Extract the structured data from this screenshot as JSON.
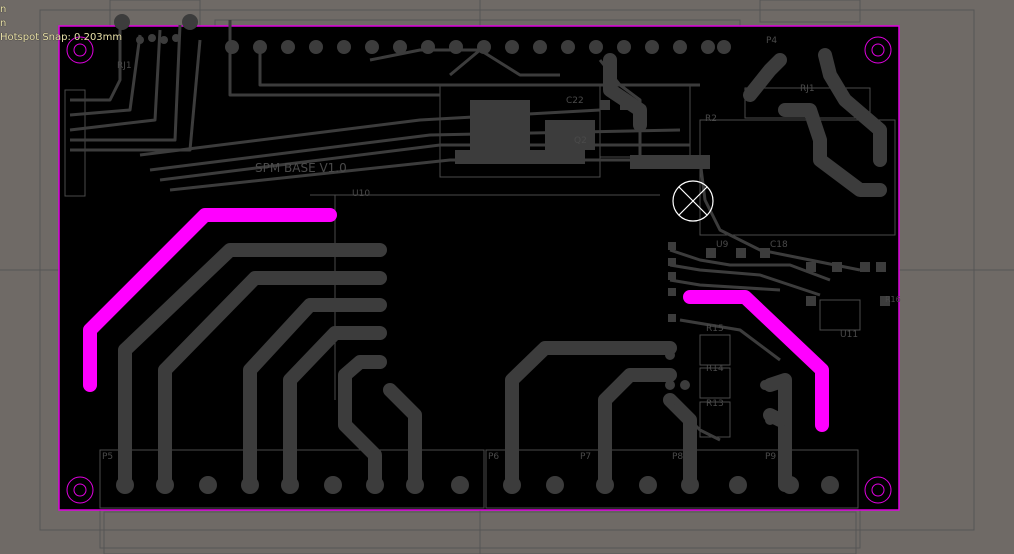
{
  "status": {
    "line1": "n",
    "line2": "n",
    "snap": "Hotspot Snap: 0.203mm"
  },
  "colors": {
    "background": "#6f6a66",
    "board": "#000000",
    "board_outline": "#e000e0",
    "trace": "#3c3c3c",
    "highlight_trace": "#ff00ff",
    "silkscreen": "#4a4a4a",
    "mechanical": "#555555"
  },
  "board": {
    "title_silk": "SPM BASE V1.0",
    "sub_silk": "U10"
  },
  "designators": {
    "rj1": "RJ1",
    "p4": "P4",
    "p5": "P5",
    "p6": "P6",
    "p7": "P7",
    "p8": "P8",
    "p9": "P9",
    "rj1b": "RJ1",
    "r2": "R2",
    "u9": "U9",
    "c18": "C18",
    "r15": "R15",
    "r14": "R14",
    "r13": "R13",
    "u11": "U11",
    "r16": "R16",
    "q2": "Q2",
    "c22": "C22"
  }
}
